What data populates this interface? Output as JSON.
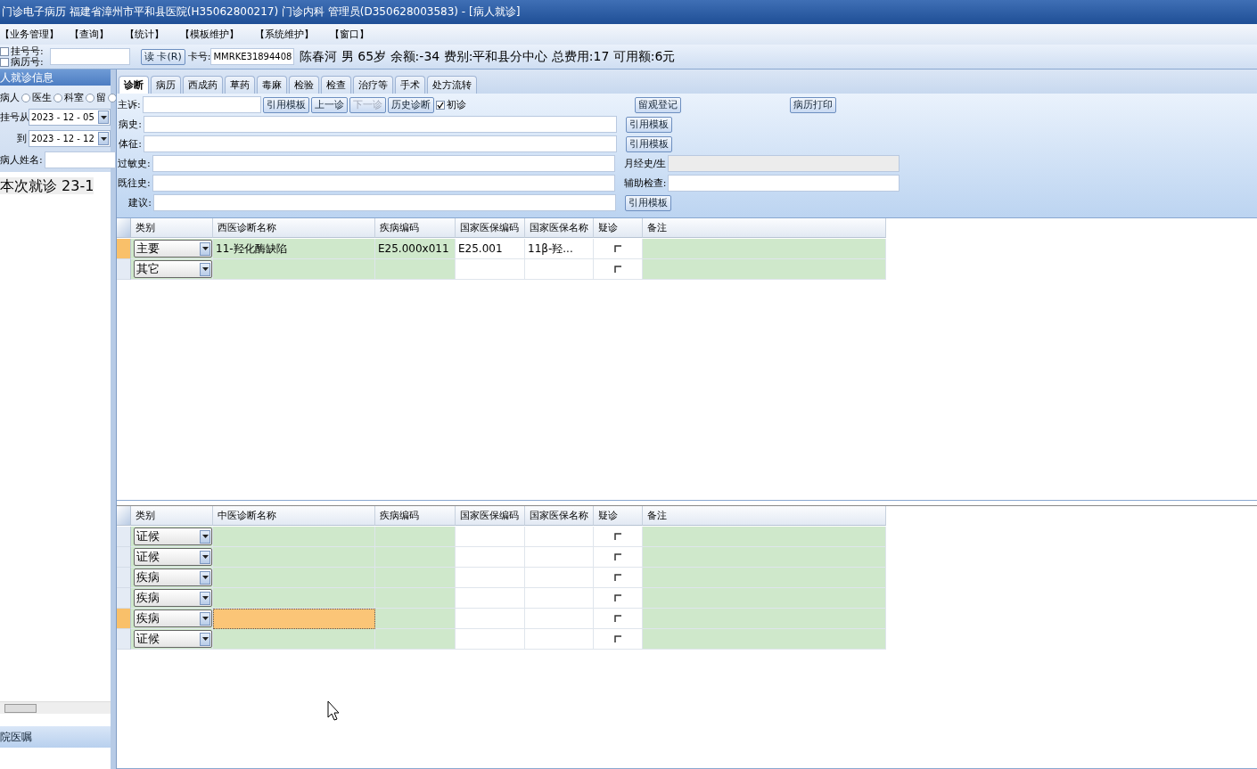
{
  "window": {
    "title": "门诊电子病历  福建省漳州市平和县医院(H35062800217)  门诊内科  管理员(D350628003583) - [病人就诊]"
  },
  "menu": [
    "【业务管理】",
    "【查询】",
    "【统计】",
    "【模板维护】",
    "【系统维护】",
    "【窗口】"
  ],
  "toolbar": {
    "id_options": [
      {
        "label": "挂号号:",
        "checked": false
      },
      {
        "label": "病历号:",
        "checked": false
      }
    ],
    "read_card": "读 卡(R)",
    "card_label": "卡号:",
    "card_value": "MMRKE31894408",
    "patient_info": "陈春河  男  65岁  余额:-34  费别:平和县分中心  总费用:17  可用额:6元"
  },
  "left_panel": {
    "title": "人就诊信息",
    "radios": [
      {
        "label": "病人",
        "selected": false
      },
      {
        "label": "医生",
        "selected": false
      },
      {
        "label": "科室",
        "selected": false
      },
      {
        "label": "留",
        "selected": false
      }
    ],
    "date_from_label": "挂号从",
    "date_from": "2023 - 12 - 05",
    "date_to_label": "到",
    "date_to": "2023 - 12 - 12",
    "name_label": "病人姓名:",
    "tree_item": "本次就诊  23-1",
    "bottom_title": "院医嘱"
  },
  "tabs": [
    {
      "label": "诊断",
      "selected": true
    },
    {
      "label": "病历",
      "selected": false
    },
    {
      "label": "西成药",
      "selected": false
    },
    {
      "label": "草药",
      "selected": false
    },
    {
      "label": "毒麻",
      "selected": false
    },
    {
      "label": "检验",
      "selected": false
    },
    {
      "label": "检查",
      "selected": false
    },
    {
      "label": "治疗等",
      "selected": false
    },
    {
      "label": "手术",
      "selected": false
    },
    {
      "label": "处方流转",
      "selected": false
    }
  ],
  "form": {
    "chief_label": "主诉:",
    "chief_buttons": [
      {
        "label": "引用模板",
        "disabled": false
      },
      {
        "label": "上一诊",
        "disabled": false
      },
      {
        "label": "下一诊",
        "disabled": true
      },
      {
        "label": "历史诊断",
        "disabled": false
      }
    ],
    "first_visit": {
      "label": "初诊",
      "checked": true
    },
    "observe_button": "留观登记",
    "print_button": "病历打印",
    "history_label": "病史:",
    "history_button": "引用模板",
    "signs_label": "体征:",
    "signs_button": "引用模板",
    "allergy_label": "过敏史:",
    "menstrual_label": "月经史/生",
    "past_label": "既往史:",
    "aux_label": "辅助检查:",
    "advice_label": "建议:",
    "advice_button": "引用模板"
  },
  "western_grid": {
    "columns": [
      "类别",
      "西医诊断名称",
      "疾病编码",
      "国家医保编码",
      "国家医保名称",
      "疑诊",
      "备注"
    ],
    "rows": [
      {
        "category": "主要",
        "name": "11-羟化酶缺陷",
        "code": "E25.000x011",
        "insurance_code": "E25.001",
        "insurance_name": "11β-羟...",
        "suspected": false,
        "selected": true,
        "editing": false
      },
      {
        "category": "其它",
        "suspected": false,
        "selected": false,
        "editing": false
      }
    ]
  },
  "tcm_grid": {
    "columns": [
      "类别",
      "中医诊断名称",
      "疾病编码",
      "国家医保编码",
      "国家医保名称",
      "疑诊",
      "备注"
    ],
    "rows": [
      {
        "category": "证候",
        "suspected": false,
        "selected": false,
        "editing": false
      },
      {
        "category": "证候",
        "suspected": false,
        "selected": false,
        "editing": false
      },
      {
        "category": "疾病",
        "suspected": false,
        "selected": false,
        "editing": false
      },
      {
        "category": "疾病",
        "suspected": false,
        "selected": false,
        "editing": false
      },
      {
        "category": "疾病",
        "suspected": false,
        "selected": true,
        "editing": true
      },
      {
        "category": "证候",
        "suspected": false,
        "selected": false,
        "editing": false
      }
    ]
  }
}
